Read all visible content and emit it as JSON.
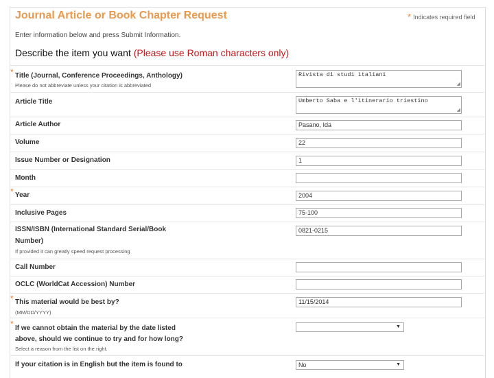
{
  "header": {
    "title": "Journal Article or Book Chapter Request",
    "required_star": "*",
    "required_note": "Indicates required field"
  },
  "intro": "Enter information below and press Submit Information.",
  "section": {
    "title_black": "Describe the item you want",
    "title_red": "(Please use Roman characters only)"
  },
  "fields": {
    "title": {
      "label": "Title (Journal, Conference Proceedings, Anthology)",
      "sub": "Please do not abbreviate unless your citation is abbreviated",
      "value": "Rivista di studi italiani"
    },
    "article_title": {
      "label": "Article Title",
      "value": "Umberto Saba e l'itinerario triestino"
    },
    "article_author": {
      "label": "Article Author",
      "value": "Pasano, Ida"
    },
    "volume": {
      "label": "Volume",
      "value": "22"
    },
    "issue": {
      "label": "Issue Number or Designation",
      "value": "1"
    },
    "month": {
      "label": "Month",
      "value": ""
    },
    "year": {
      "label": "Year",
      "value": "2004"
    },
    "pages": {
      "label": "Inclusive Pages",
      "value": "75-100"
    },
    "issn": {
      "label_line1": "ISSN/ISBN (International Standard Serial/Book",
      "label_line2": "Number)",
      "sub": "If provided it can greatly speed request processing",
      "value": "0821-0215"
    },
    "call_number": {
      "label": "Call Number",
      "value": ""
    },
    "oclc": {
      "label": "OCLC (WorldCat Accession) Number",
      "value": ""
    },
    "needed_by": {
      "label": "This material would be best by?",
      "sub": "(MM/DD/YYYY)",
      "value": "11/15/2014"
    },
    "continue": {
      "label_line1": "If we cannot obtain the material by the date listed",
      "label_line2": "above, should we continue to try and for how long?",
      "sub": "Select a reason from the list on the right.",
      "value": ""
    },
    "english": {
      "label": "If your citation is in English but the item is found to",
      "value": "No"
    }
  },
  "icons": {
    "required": "asterisk-icon",
    "dropdown": "chevron-down-icon",
    "resize": "resize-handle-icon"
  },
  "colors": {
    "header": "#e89a4e",
    "red": "#c0161b",
    "required": "#e8843a"
  }
}
